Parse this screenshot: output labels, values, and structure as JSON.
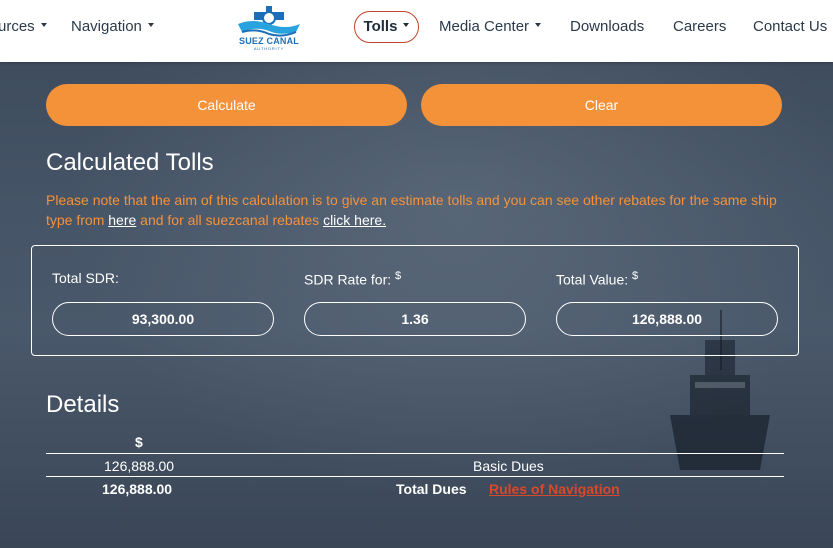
{
  "header": {
    "nav": {
      "resources_partial": "urces",
      "navigation": "Navigation",
      "tolls": "Tolls",
      "media_center": "Media Center",
      "downloads": "Downloads",
      "careers": "Careers",
      "contact_us": "Contact Us"
    },
    "logo": {
      "name": "SUEZ CANAL",
      "subtitle": "AUTHORITY"
    }
  },
  "actions": {
    "calculate": "Calculate",
    "clear": "Clear"
  },
  "calculated": {
    "title": "Calculated Tolls",
    "note_part1": "Please note that the aim of this calculation is to give an estimate tolls and you can see other rebates for the same ship type from ",
    "note_link1": "here",
    "note_part2": " and for all suezcanal rebates ",
    "note_link2": "click here."
  },
  "results": {
    "total_sdr_label": "Total SDR:",
    "total_sdr_value": "93,300.00",
    "sdr_rate_label": "SDR Rate for: ",
    "sdr_rate_currency": "$",
    "sdr_rate_value": "1.36",
    "total_value_label": "Total Value: ",
    "total_value_currency": "$",
    "total_value_value": "126,888.00"
  },
  "details": {
    "title": "Details",
    "currency_header": "$",
    "rows": [
      {
        "amount": "126,888.00",
        "label": "Basic Dues"
      },
      {
        "amount": "126,888.00",
        "label": "Total Dues",
        "link": "Rules of Navigation"
      }
    ]
  },
  "colors": {
    "accent": "#f4923a",
    "link_red": "#d9482b",
    "tolls_border": "#c0432a",
    "brand_blue": "#1b6fb8"
  }
}
